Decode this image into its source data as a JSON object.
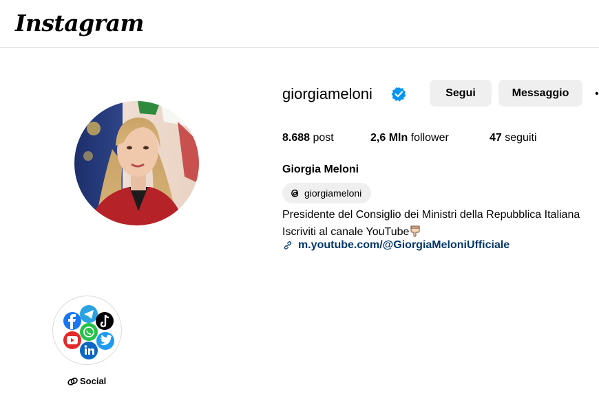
{
  "app": {
    "logo_text": "Instagram"
  },
  "profile": {
    "username": "giorgiameloni",
    "verified": true,
    "buttons": {
      "follow": "Segui",
      "message": "Messaggio"
    },
    "stats": {
      "posts_value": "8.688",
      "posts_label": " post",
      "followers_value": "2,6 Mln",
      "followers_label": " follower",
      "following_value": "47",
      "following_label": " seguiti"
    },
    "full_name": "Giorgia Meloni",
    "threads_handle": "giorgiameloni",
    "bio_line1": "Presidente del Consiglio dei Ministri della Repubblica Italiana",
    "bio_line2": "Iscriviti al canale YouTube",
    "link": "m.youtube.com/@GiorgiaMeloniUfficiale"
  },
  "highlight": {
    "label": "Social"
  },
  "colors": {
    "verified_blue": "#0095f6",
    "link_blue": "#00376b",
    "button_gray": "#efefef",
    "divider": "#dbdbdb"
  },
  "icons": [
    "verified-badge-icon",
    "more-options-icon",
    "threads-icon",
    "link-icon",
    "chain-link-icon",
    "facebook-icon",
    "telegram-icon",
    "tiktok-icon",
    "youtube-icon",
    "whatsapp-icon",
    "twitter-icon",
    "linkedin-icon",
    "pointing-down-emoji"
  ]
}
